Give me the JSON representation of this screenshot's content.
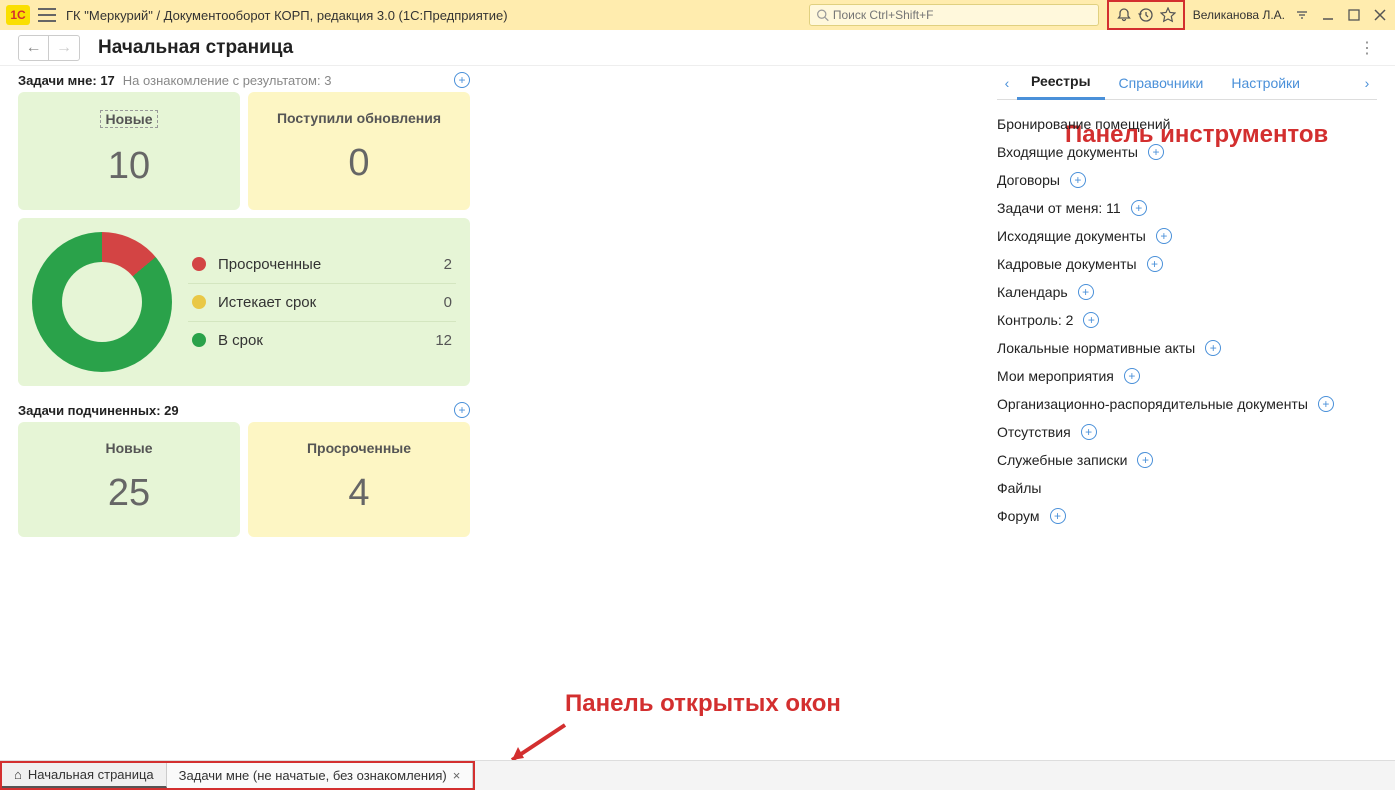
{
  "titlebar": {
    "title": "ГК \"Меркурий\" / Документооборот КОРП, редакция 3.0  (1С:Предприятие)",
    "search_placeholder": "Поиск Ctrl+Shift+F",
    "username": "Великанова Л.А."
  },
  "page_title": "Начальная страница",
  "annotations": {
    "toolbar": "Панель инструментов",
    "windows": "Панель открытых окон"
  },
  "tasks_mine": {
    "header": "Задачи мне: 17",
    "subheader": "На ознакомление с результатом: 3",
    "cards": [
      {
        "label": "Новые",
        "value": "10",
        "cls": "c-green",
        "boxed": true
      },
      {
        "label": "Поступили обновления",
        "value": "0",
        "cls": "c-yellow",
        "boxed": false
      }
    ]
  },
  "chart_data": {
    "type": "pie",
    "title": "",
    "series": [
      {
        "name": "Просроченные",
        "value": 2,
        "color": "#d34444"
      },
      {
        "name": "Истекает срок",
        "value": 0,
        "color": "#e9c846"
      },
      {
        "name": "В срок",
        "value": 12,
        "color": "#2aa24a"
      }
    ]
  },
  "tasks_sub": {
    "header": "Задачи подчиненных: 29",
    "cards": [
      {
        "label": "Новые",
        "value": "25",
        "cls": "c-green"
      },
      {
        "label": "Просроченные",
        "value": "4",
        "cls": "c-yellow"
      }
    ]
  },
  "rtabs": [
    {
      "label": "Реестры",
      "active": true
    },
    {
      "label": "Справочники",
      "active": false
    },
    {
      "label": "Настройки",
      "active": false
    }
  ],
  "rlist": [
    {
      "label": "Бронирование помещений",
      "plus": false
    },
    {
      "label": "Входящие документы",
      "plus": true
    },
    {
      "label": "Договоры",
      "plus": true
    },
    {
      "label": "Задачи от меня: 11",
      "plus": true
    },
    {
      "label": "Исходящие документы",
      "plus": true
    },
    {
      "label": "Кадровые документы",
      "plus": true
    },
    {
      "label": "Календарь",
      "plus": true
    },
    {
      "label": "Контроль: 2",
      "plus": true
    },
    {
      "label": "Локальные нормативные акты",
      "plus": true
    },
    {
      "label": "Мои мероприятия",
      "plus": true
    },
    {
      "label": "Организационно-распорядительные документы",
      "plus": true
    },
    {
      "label": "Отсутствия",
      "plus": true
    },
    {
      "label": "Служебные записки",
      "plus": true
    },
    {
      "label": "Файлы",
      "plus": false
    },
    {
      "label": "Форум",
      "plus": true
    }
  ],
  "bottom_tabs": [
    {
      "label": "Начальная страница",
      "home": true,
      "active": true,
      "close": false
    },
    {
      "label": "Задачи мне (не начатые, без ознакомления)",
      "home": false,
      "active": false,
      "close": true
    }
  ]
}
